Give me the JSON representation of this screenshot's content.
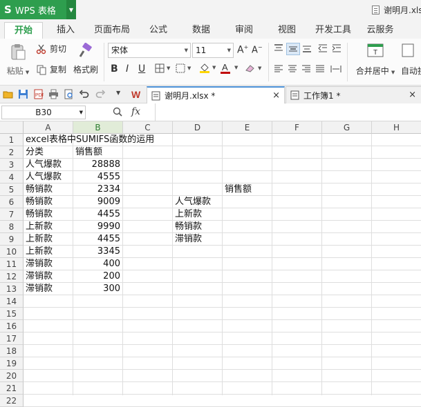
{
  "app": {
    "logo": "S",
    "name": "WPS 表格"
  },
  "window": {
    "doc_title": "谢明月.xlsx"
  },
  "menu": {
    "tabs": [
      "开始",
      "插入",
      "页面布局",
      "公式",
      "数据",
      "审阅",
      "视图",
      "开发工具",
      "云服务"
    ],
    "active_index": 0
  },
  "ribbon": {
    "paste": "粘贴",
    "cut": "剪切",
    "copy": "复制",
    "format_painter": "格式刷",
    "font_name": "宋体",
    "font_size": "11",
    "merge_center": "合并居中",
    "auto_wrap": "自动换",
    "font_color": "#c00000",
    "fill_color": "#ffd600"
  },
  "doc_tabs": [
    {
      "label": "谢明月.xlsx *",
      "active": true
    },
    {
      "label": "工作簿1 *",
      "active": false
    }
  ],
  "formula_bar": {
    "cell_ref": "B30",
    "fx": "fx",
    "content": ""
  },
  "sheet": {
    "columns": [
      "A",
      "B",
      "C",
      "D",
      "E",
      "F",
      "G",
      "H"
    ],
    "selected_column": "B",
    "rows": [
      "1",
      "2",
      "3",
      "4",
      "5",
      "6",
      "7",
      "8",
      "9",
      "10",
      "11",
      "12",
      "13",
      "14",
      "15",
      "16",
      "17",
      "18",
      "19",
      "20",
      "21",
      "22"
    ],
    "cells": {
      "A1": "excel表格中SUMIFS函数的运用",
      "A2": "分类",
      "B2": "销售额",
      "A3": "人气爆款",
      "B3": "28888",
      "A4": "人气爆款",
      "B4": "4555",
      "A5": "畅销款",
      "B5": "2334",
      "A6": "畅销款",
      "B6": "9009",
      "A7": "畅销款",
      "B7": "4455",
      "A8": "上新款",
      "B8": "9990",
      "A9": "上新款",
      "B9": "4455",
      "A10": "上新款",
      "B10": "3345",
      "A11": "滞销款",
      "B11": "400",
      "A12": "滞销款",
      "B12": "200",
      "A13": "滞销款",
      "B13": "300",
      "E5": "销售额",
      "D6": "人气爆款",
      "D7": "上新款",
      "D8": "畅销款",
      "D9": "滞销款"
    }
  }
}
